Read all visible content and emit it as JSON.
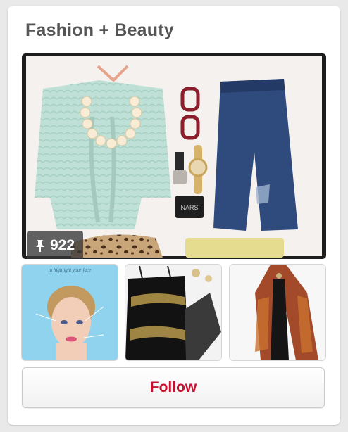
{
  "board": {
    "title": "Fashion + Beauty",
    "pin_count": "922",
    "pin_icon": "pushpin-icon"
  },
  "cover": {
    "brand_text": "NARS"
  },
  "thumbnails": {
    "first_caption": "to highlight your face"
  },
  "follow_button": {
    "label": "Follow",
    "color": "#c8102e"
  }
}
